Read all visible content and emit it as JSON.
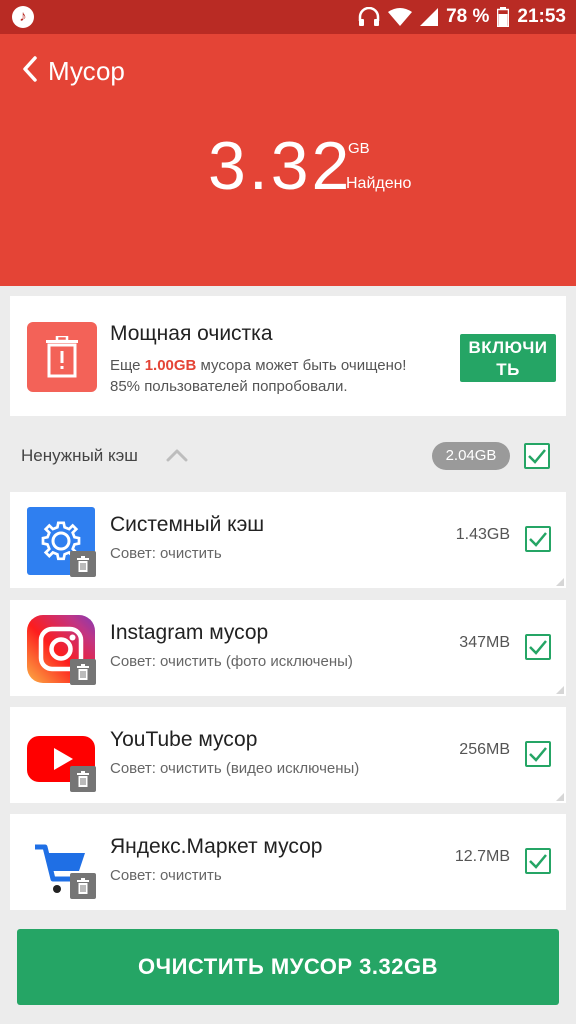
{
  "status_bar": {
    "battery": "78 %",
    "time": "21:53",
    "icons": [
      "music-icon",
      "headphones-icon",
      "wifi-icon",
      "signal-icon",
      "battery-icon"
    ]
  },
  "header": {
    "title": "Мусор",
    "size_value": "3.32",
    "size_unit": "GB",
    "found_label": "Найдено",
    "background": "#e44436"
  },
  "power_clean": {
    "title": "Мощная очистка",
    "line1_prefix": "Еще ",
    "line1_highlight": "1.00GB",
    "line1_suffix": " мусора может быть очищено!",
    "line2": "85% пользователей попробовали.",
    "button_line1": "ВКЛЮЧИ",
    "button_line2": "ТЬ",
    "icon": "trash-alert-icon"
  },
  "section": {
    "title": "Ненужный кэш",
    "size": "2.04GB",
    "checked": true
  },
  "items": [
    {
      "name": "Системный кэш",
      "hint": "Совет: очистить",
      "size": "1.43GB",
      "checked": true,
      "icon": "gear-icon"
    },
    {
      "name": "Instagram мусор",
      "hint": "Совет: очистить (фото исключены)",
      "size": "347MB",
      "checked": true,
      "icon": "instagram-icon"
    },
    {
      "name": "YouTube мусор",
      "hint": "Совет: очистить (видео исключены)",
      "size": "256MB",
      "checked": true,
      "icon": "youtube-icon"
    },
    {
      "name": "Яндекс.Маркет мусор",
      "hint": "Совет: очистить",
      "size": "12.7MB",
      "checked": true,
      "icon": "shopping-cart-icon"
    }
  ],
  "clean_button": {
    "label": "ОЧИСТИТЬ МУСОР 3.32GB"
  },
  "colors": {
    "accent_red": "#e44436",
    "accent_green": "#25a565"
  }
}
